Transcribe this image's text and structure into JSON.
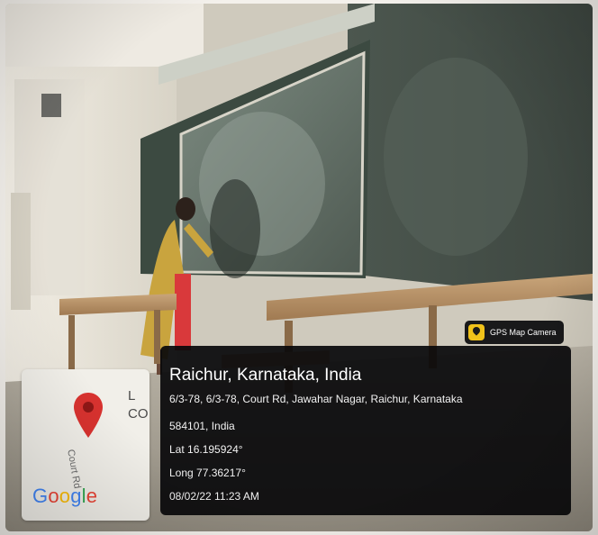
{
  "photo": {
    "subject": "classroom-blackboard-scene"
  },
  "map_thumbnail": {
    "road_label": "Court Rd",
    "partial_text": "L\nCO",
    "pin_icon": "map-pin-icon",
    "logo": {
      "letters": [
        "G",
        "o",
        "o",
        "g",
        "l",
        "e"
      ],
      "colors": [
        "#4285F4",
        "#EA4335",
        "#FBBC05",
        "#4285F4",
        "#34A853",
        "#EA4335"
      ]
    }
  },
  "badge": {
    "icon": "gps-camera-icon",
    "label": "GPS Map Camera"
  },
  "location": {
    "title": "Raichur, Karnataka, India",
    "address_line1": "6/3-78, 6/3-78, Court Rd, Jawahar Nagar, Raichur, Karnataka",
    "address_line2": "584101, India",
    "lat": "Lat 16.195924°",
    "long": "Long 77.36217°",
    "timestamp": "08/02/22 11:23 AM"
  }
}
